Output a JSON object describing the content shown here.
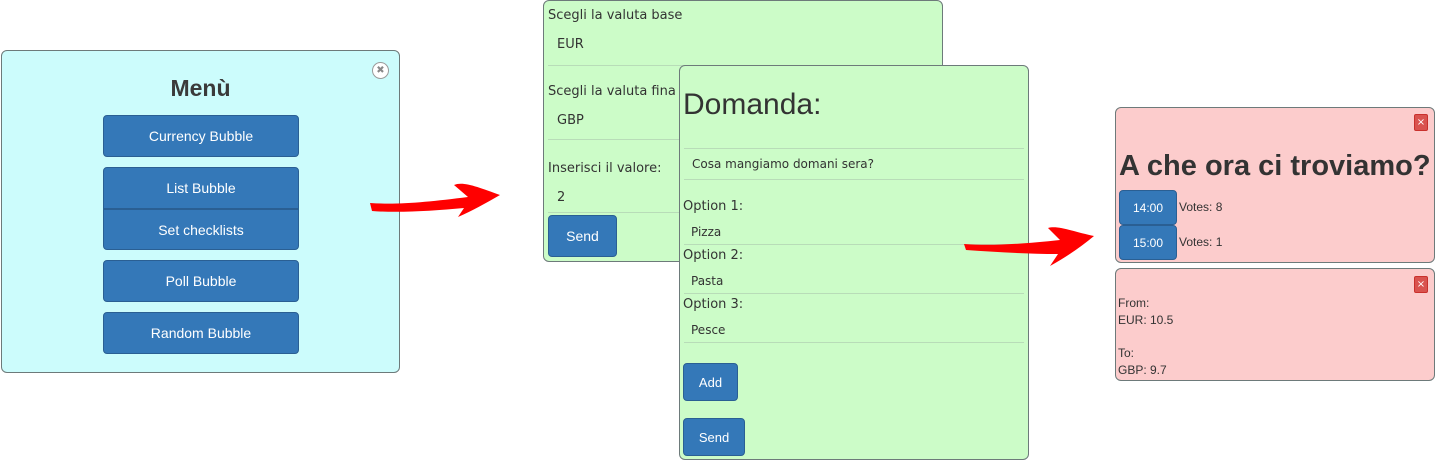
{
  "menu": {
    "title": "Menù",
    "close_icon": "close-circle-icon",
    "items": [
      "Currency Bubble",
      "List Bubble",
      "Set checklists",
      "Poll Bubble",
      "Random Bubble"
    ],
    "bg_color": "#ccfcfc"
  },
  "currency_form": {
    "base_label": "Scegli la valuta base",
    "base_value": "EUR",
    "final_label": "Scegli la valuta fina",
    "final_value": "GBP",
    "amount_label": "Inserisci il valore:",
    "amount_value": "2",
    "send_label": "Send",
    "bg_color": "#ccfcc8"
  },
  "poll_form": {
    "title": "Domanda:",
    "question_value": "Cosa mangiamo domani sera?",
    "options": [
      {
        "label": "Option 1:",
        "value": "Pizza"
      },
      {
        "label": "Option 2:",
        "value": "Pasta"
      },
      {
        "label": "Option 3:",
        "value": "Pesce"
      }
    ],
    "add_label": "Add",
    "send_label": "Send"
  },
  "poll_result": {
    "title": "A che ora ci troviamo?",
    "close_label": "×",
    "options": [
      {
        "label": "14:00",
        "votes": "Votes: 8"
      },
      {
        "label": "15:00",
        "votes": "Votes: 1"
      }
    ],
    "bg_color": "#fccccc"
  },
  "currency_result": {
    "close_label": "×",
    "from_label": "From:",
    "from_value": "EUR: 10.5",
    "to_label": "To:",
    "to_value": "GBP: 9.7"
  },
  "arrows": {
    "color": "#ff0000",
    "icon": "arrow-right-icon"
  }
}
